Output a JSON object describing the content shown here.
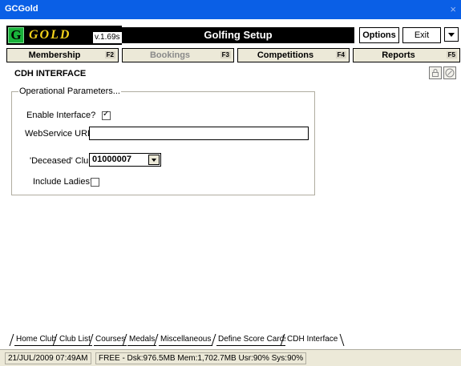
{
  "window": {
    "title": "GCGold",
    "close_glyph": "×"
  },
  "logo": {
    "letter": "G",
    "word": "GOLD",
    "version": "v.1.69s"
  },
  "header": {
    "module_title": "Golfing Setup",
    "options_label": "Options",
    "exit_label": "Exit"
  },
  "nav": {
    "tabs": [
      {
        "label": "Membership",
        "key": "F2",
        "enabled": true
      },
      {
        "label": "Bookings",
        "key": "F3",
        "enabled": false
      },
      {
        "label": "Competitions",
        "key": "F4",
        "enabled": true
      },
      {
        "label": "Reports",
        "key": "F5",
        "enabled": true
      }
    ]
  },
  "page": {
    "heading": "CDH INTERFACE",
    "icons": [
      "lock-icon",
      "record-icon"
    ]
  },
  "form": {
    "group_label": "Operational Parameters...",
    "enable_label": "Enable Interface?",
    "enable_checked": true,
    "url_label": "WebService URL:",
    "url_value": "",
    "club_label": "'Deceased' Club:",
    "club_value": "01000007",
    "ladies_label": "Include Ladies?",
    "ladies_checked": false,
    "check_glyph": "✓"
  },
  "subtabs": [
    {
      "label": "Home Club",
      "active": false
    },
    {
      "label": "Club List",
      "active": false
    },
    {
      "label": "Courses",
      "active": false
    },
    {
      "label": "Medals",
      "active": false
    },
    {
      "label": "Miscellaneous",
      "active": false
    },
    {
      "label": "Define Score Cards",
      "active": false
    },
    {
      "label": "CDH Interface",
      "active": true
    }
  ],
  "status": {
    "datetime": "21/JUL/2009 07:49AM",
    "resources": "FREE - Dsk:976.5MB  Mem:1,702.7MB  Usr:90%  Sys:90%"
  },
  "colors": {
    "titlebar": "#0a5fe6",
    "logo_gold": "#f2d11b",
    "logo_green": "#19b23b"
  }
}
